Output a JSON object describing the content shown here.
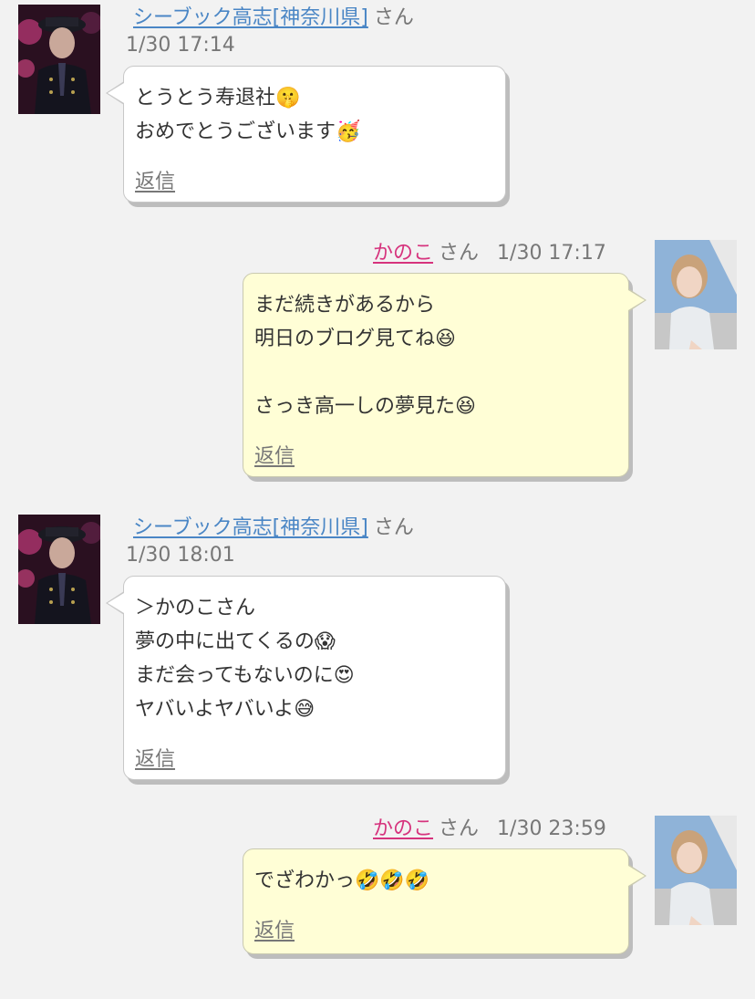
{
  "messages": [
    {
      "side": "left",
      "name": "シーブック高志[神奈川県]",
      "suffix": "さん",
      "time": "1/30 17:14",
      "lines": [
        "とうとう寿退社🤫",
        "おめでとうございます🥳"
      ],
      "reply": "返信"
    },
    {
      "side": "right",
      "name": "かのこ",
      "suffix": "さん",
      "time": "1/30 17:17",
      "lines": [
        "まだ続きがあるから",
        "明日のブログ見てね😆",
        "",
        "さっき高一しの夢見た😆"
      ],
      "reply": "返信"
    },
    {
      "side": "left",
      "name": "シーブック高志[神奈川県]",
      "suffix": "さん",
      "time": "1/30 18:01",
      "lines": [
        "＞かのこさん",
        "夢の中に出てくるの😱",
        "まだ会ってもないのに😍",
        "ヤバいよヤバいよ😅"
      ],
      "reply": "返信"
    },
    {
      "side": "right",
      "name": "かのこ",
      "suffix": "さん",
      "time": "1/30 23:59",
      "lines": [
        "でざわかっ🤣🤣🤣"
      ],
      "reply": "返信"
    }
  ],
  "colors": {
    "background": "#f2f2f2",
    "left_name": "#4a86c5",
    "right_name": "#d6337d",
    "left_bubble": "#ffffff",
    "right_bubble": "#fffed6"
  }
}
